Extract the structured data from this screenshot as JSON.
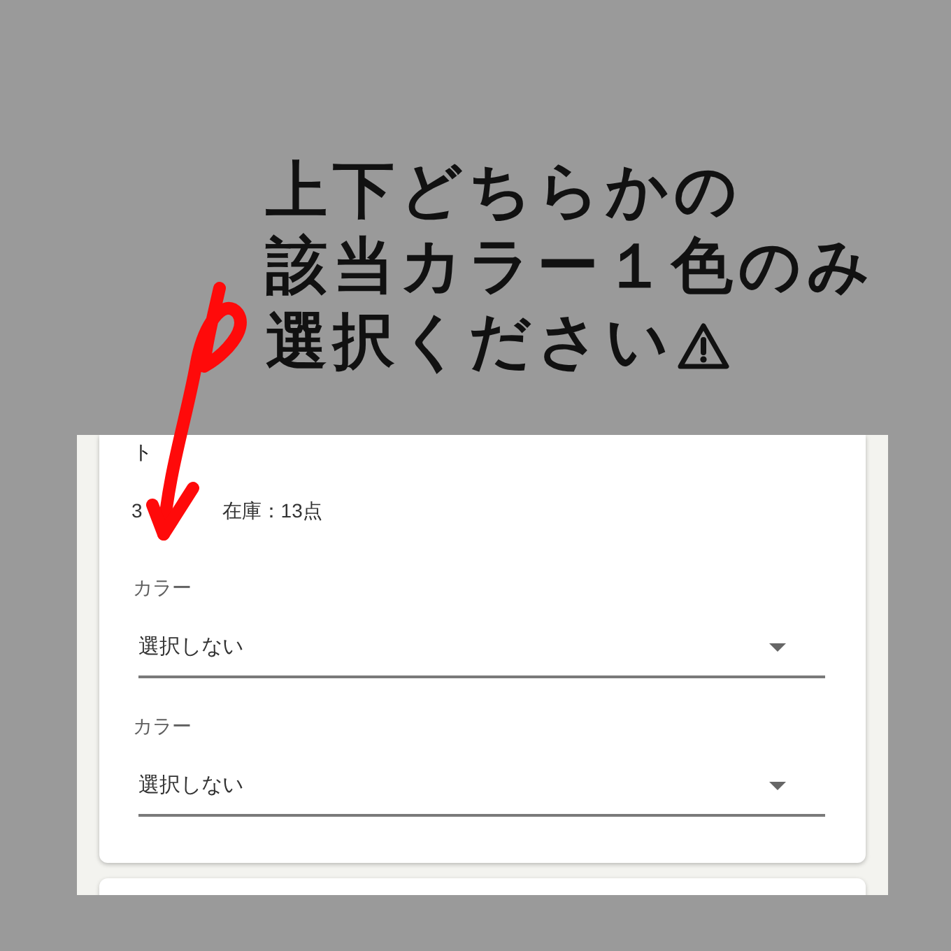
{
  "heading": {
    "lines": [
      "上下どちらかの",
      "該当カラー１色のみ",
      "選択ください"
    ]
  },
  "card": {
    "title": "ト",
    "price": "3",
    "stock": "在庫：13点",
    "selects": [
      {
        "label": "カラー",
        "value": "選択しない"
      },
      {
        "label": "カラー",
        "value": "選択しない"
      }
    ]
  }
}
